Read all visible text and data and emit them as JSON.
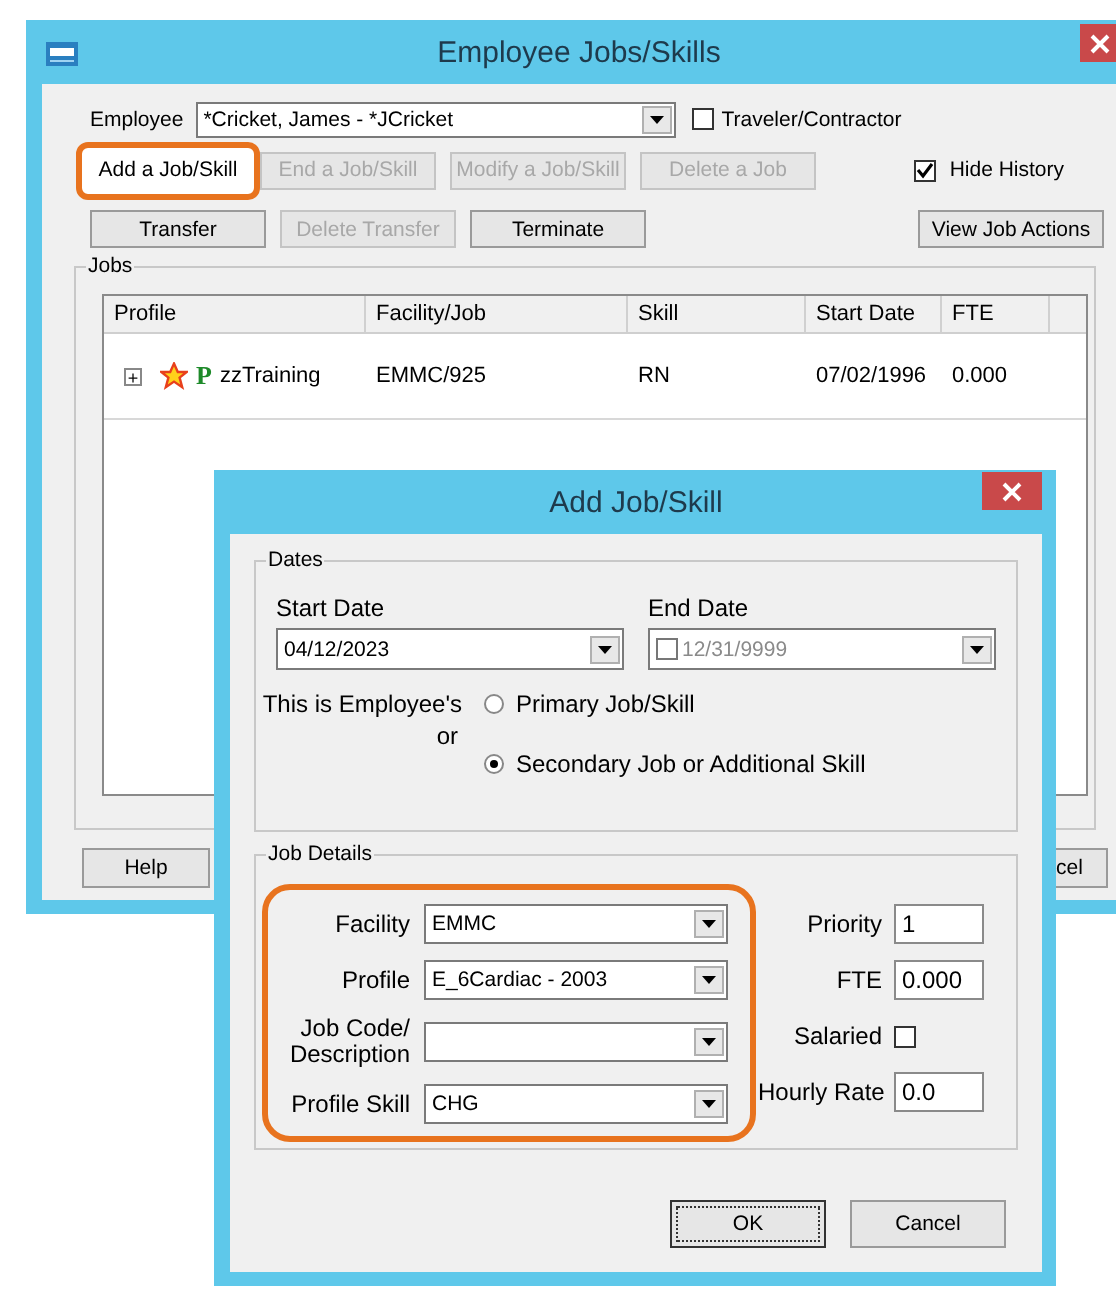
{
  "main_window": {
    "title": "Employee Jobs/Skills",
    "employee": {
      "label": "Employee",
      "value": "*Cricket, James - *JCricket"
    },
    "traveler": {
      "label": "Traveler/Contractor",
      "checked": false
    },
    "hide_history": {
      "label": "Hide History",
      "checked": true
    },
    "buttons_row1": [
      {
        "label": "Add a Job/Skill",
        "disabled": false,
        "highlighted": true
      },
      {
        "label": "End a Job/Skill",
        "disabled": true,
        "highlighted": false
      },
      {
        "label": "Modify a Job/Skill",
        "disabled": true,
        "highlighted": false
      },
      {
        "label": "Delete a Job",
        "disabled": true,
        "highlighted": false
      }
    ],
    "buttons_row2": [
      {
        "label": "Transfer",
        "disabled": false
      },
      {
        "label": "Delete Transfer",
        "disabled": true
      },
      {
        "label": "Terminate",
        "disabled": false
      }
    ],
    "view_actions": "View Job Actions",
    "jobs": {
      "title": "Jobs",
      "columns": [
        "Profile",
        "Facility/Job",
        "Skill",
        "Start Date",
        "FTE"
      ],
      "rows": [
        {
          "expander": "+",
          "badge": "P",
          "profile": "zzTraining",
          "facility_job": "EMMC/925",
          "skill": "RN",
          "start_date": "07/02/1996",
          "fte": "0.000"
        }
      ]
    },
    "footer_buttons": [
      "Help",
      "cel"
    ]
  },
  "dialog": {
    "title": "Add Job/Skill",
    "dates": {
      "title": "Dates",
      "start_label": "Start Date",
      "start_value": "04/12/2023",
      "end_label": "End Date",
      "end_value": "12/31/9999",
      "end_enabled": false,
      "role_label": "This is Employee's",
      "or_label": "or",
      "roles": [
        {
          "label": "Primary Job/Skill",
          "selected": false
        },
        {
          "label": "Secondary Job or Additional Skill",
          "selected": true
        }
      ]
    },
    "job_details": {
      "title": "Job Details",
      "highlighted": true,
      "fields": [
        {
          "label": "Facility",
          "value": "EMMC"
        },
        {
          "label": "Profile",
          "value": "E_6Cardiac - 2003"
        },
        {
          "label": "Job Code/\nDescription"
        },
        {
          "label": "Profile Skill",
          "value": "CHG"
        }
      ],
      "side_fields": [
        {
          "kind": "text",
          "label": "Priority",
          "value": "1"
        },
        {
          "kind": "text",
          "label": "FTE",
          "value": "0.000"
        },
        {
          "kind": "checkbox",
          "label": "Salaried",
          "checked": false
        },
        {
          "kind": "text",
          "label": "Hourly Rate",
          "value": "0.0"
        }
      ]
    },
    "buttons": [
      {
        "label": "OK",
        "default": true
      },
      {
        "label": "Cancel",
        "default": false
      }
    ]
  }
}
